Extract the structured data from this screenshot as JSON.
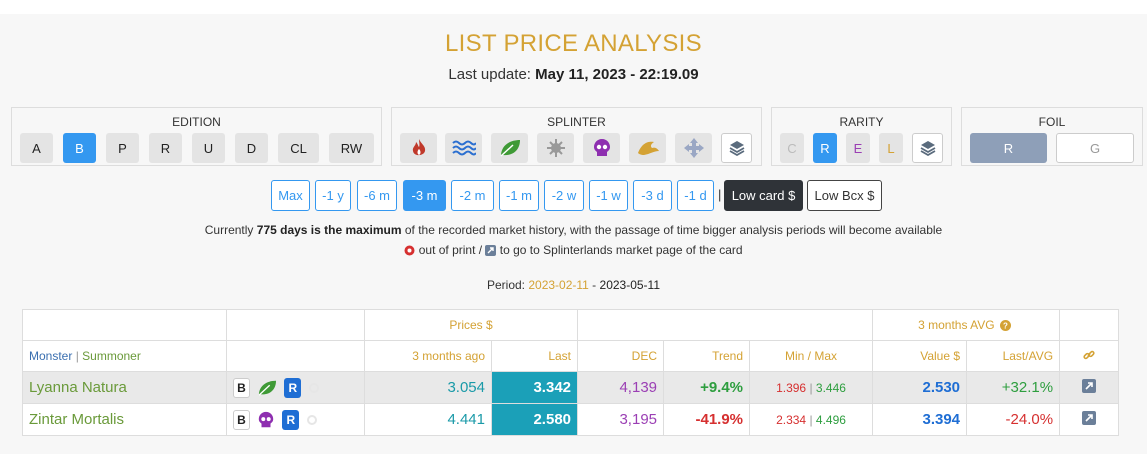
{
  "header": {
    "title": "LIST PRICE ANALYSIS",
    "update_prefix": "Last update: ",
    "update_value": "May 11, 2023 - 22:19.09"
  },
  "filters": {
    "edition": {
      "label": "EDITION",
      "options": [
        "A",
        "B",
        "P",
        "R",
        "U",
        "D",
        "CL",
        "RW"
      ],
      "selected": "B"
    },
    "splinter": {
      "label": "SPLINTER",
      "options": [
        "fire-icon",
        "water-icon",
        "earth-icon",
        "life-icon",
        "death-icon",
        "dragon-icon",
        "neutral-icon",
        "all-icon"
      ],
      "selected": "none"
    },
    "rarity": {
      "label": "RARITY",
      "options": [
        "C",
        "R",
        "E",
        "L"
      ],
      "selected": "R"
    },
    "foil": {
      "label": "FOIL",
      "options": [
        "R",
        "G"
      ],
      "selected": "R"
    }
  },
  "periods": {
    "options": [
      "Max",
      "-1 y",
      "-6 m",
      "-3 m",
      "-2 m",
      "-1 m",
      "-2 w",
      "-1 w",
      "-3 d",
      "-1 d"
    ],
    "selected": "-3 m",
    "separator": "|",
    "low_card": "Low card $",
    "low_bcx": "Low Bcx $"
  },
  "notes": {
    "line1_prefix": "Currently ",
    "line1_bold": "775 days is the maximum",
    "line1_suffix": " of the recorded market history, with the passage of time bigger analysis periods will become available",
    "line2_a": " out of print / ",
    "line2_b": " to go to Splinterlands market page of the card"
  },
  "period": {
    "label": "Period: ",
    "start": "2023-02-11",
    "dash": " - ",
    "end": "2023-05-11"
  },
  "table": {
    "group_headers": {
      "prices": "Prices $",
      "avg": "3 months AVG"
    },
    "headers": {
      "monster": "Monster",
      "pipe": " | ",
      "summoner": "Summoner",
      "ago": "3 months ago",
      "last": "Last",
      "dec": "DEC",
      "trend": "Trend",
      "minmax": "Min / Max",
      "value": "Value $",
      "last_avg": "Last/AVG"
    },
    "rows": [
      {
        "name": "Lyanna Natura",
        "edition": "B",
        "splinter": "earth-icon",
        "rarity": "R",
        "ago": "3.054",
        "last": "3.342",
        "dec": "4,139",
        "trend": "+9.4%",
        "min": "1.396",
        "max": "3.446",
        "value": "2.530",
        "last_avg": "+32.1%"
      },
      {
        "name": "Zintar Mortalis",
        "edition": "B",
        "splinter": "death-icon",
        "rarity": "R",
        "ago": "4.441",
        "last": "2.580",
        "dec": "3,195",
        "trend": "-41.9%",
        "min": "2.334",
        "max": "4.496",
        "value": "3.394",
        "last_avg": "-24.0%"
      }
    ]
  },
  "colors": {
    "accent_gold": "#d4a234",
    "primary_blue": "#3498f0",
    "last_cell_teal": "#1ba0b8"
  }
}
